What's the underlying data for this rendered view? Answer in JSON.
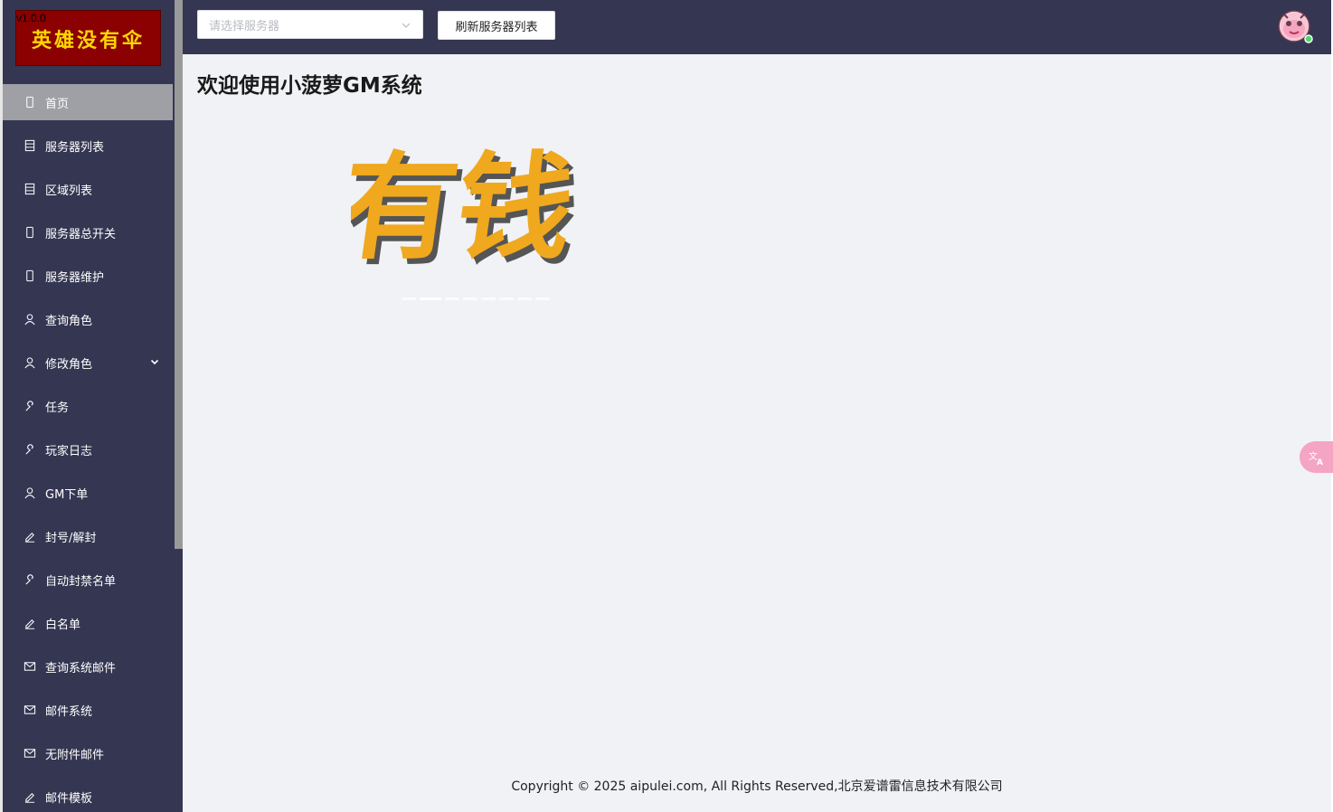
{
  "app": {
    "version": "v1.0.0",
    "logo_text": "英雄没有伞"
  },
  "sidebar": {
    "items": [
      {
        "label": "首页",
        "icon": "phone-icon",
        "active": true
      },
      {
        "label": "服务器列表",
        "icon": "list-icon"
      },
      {
        "label": "区域列表",
        "icon": "list-icon"
      },
      {
        "label": "服务器总开关",
        "icon": "phone-icon"
      },
      {
        "label": "服务器维护",
        "icon": "phone-icon"
      },
      {
        "label": "查询角色",
        "icon": "user-icon"
      },
      {
        "label": "修改角色",
        "icon": "user-icon",
        "has_submenu": true
      },
      {
        "label": "任务",
        "icon": "wrench-icon"
      },
      {
        "label": "玩家日志",
        "icon": "wrench-icon"
      },
      {
        "label": "GM下单",
        "icon": "user-icon"
      },
      {
        "label": "封号/解封",
        "icon": "edit-icon"
      },
      {
        "label": "自动封禁名单",
        "icon": "wrench-icon"
      },
      {
        "label": "白名单",
        "icon": "edit-icon"
      },
      {
        "label": "查询系统邮件",
        "icon": "mail-icon"
      },
      {
        "label": "邮件系统",
        "icon": "mail-icon"
      },
      {
        "label": "无附件邮件",
        "icon": "mail-icon"
      },
      {
        "label": "邮件模板",
        "icon": "edit-icon"
      }
    ]
  },
  "header": {
    "server_select_placeholder": "请选择服务器",
    "refresh_label": "刷新服务器列表"
  },
  "main": {
    "title": "欢迎使用小菠萝GM系统",
    "banner_text": "有钱",
    "carousel_count": 8,
    "carousel_active": 1
  },
  "footer": {
    "copyright": "Copyright © 2025 aipulei.com, All Rights Reserved,北京爱谱雷信息技术有限公司"
  },
  "colors": {
    "sidebar_bg": "#343652",
    "header_bg": "#343652",
    "active_item_bg": "#9ea0a5",
    "main_bg": "#f0f2f5",
    "banner_gold": "#f0a81e",
    "logo_bg": "#8b0000"
  }
}
